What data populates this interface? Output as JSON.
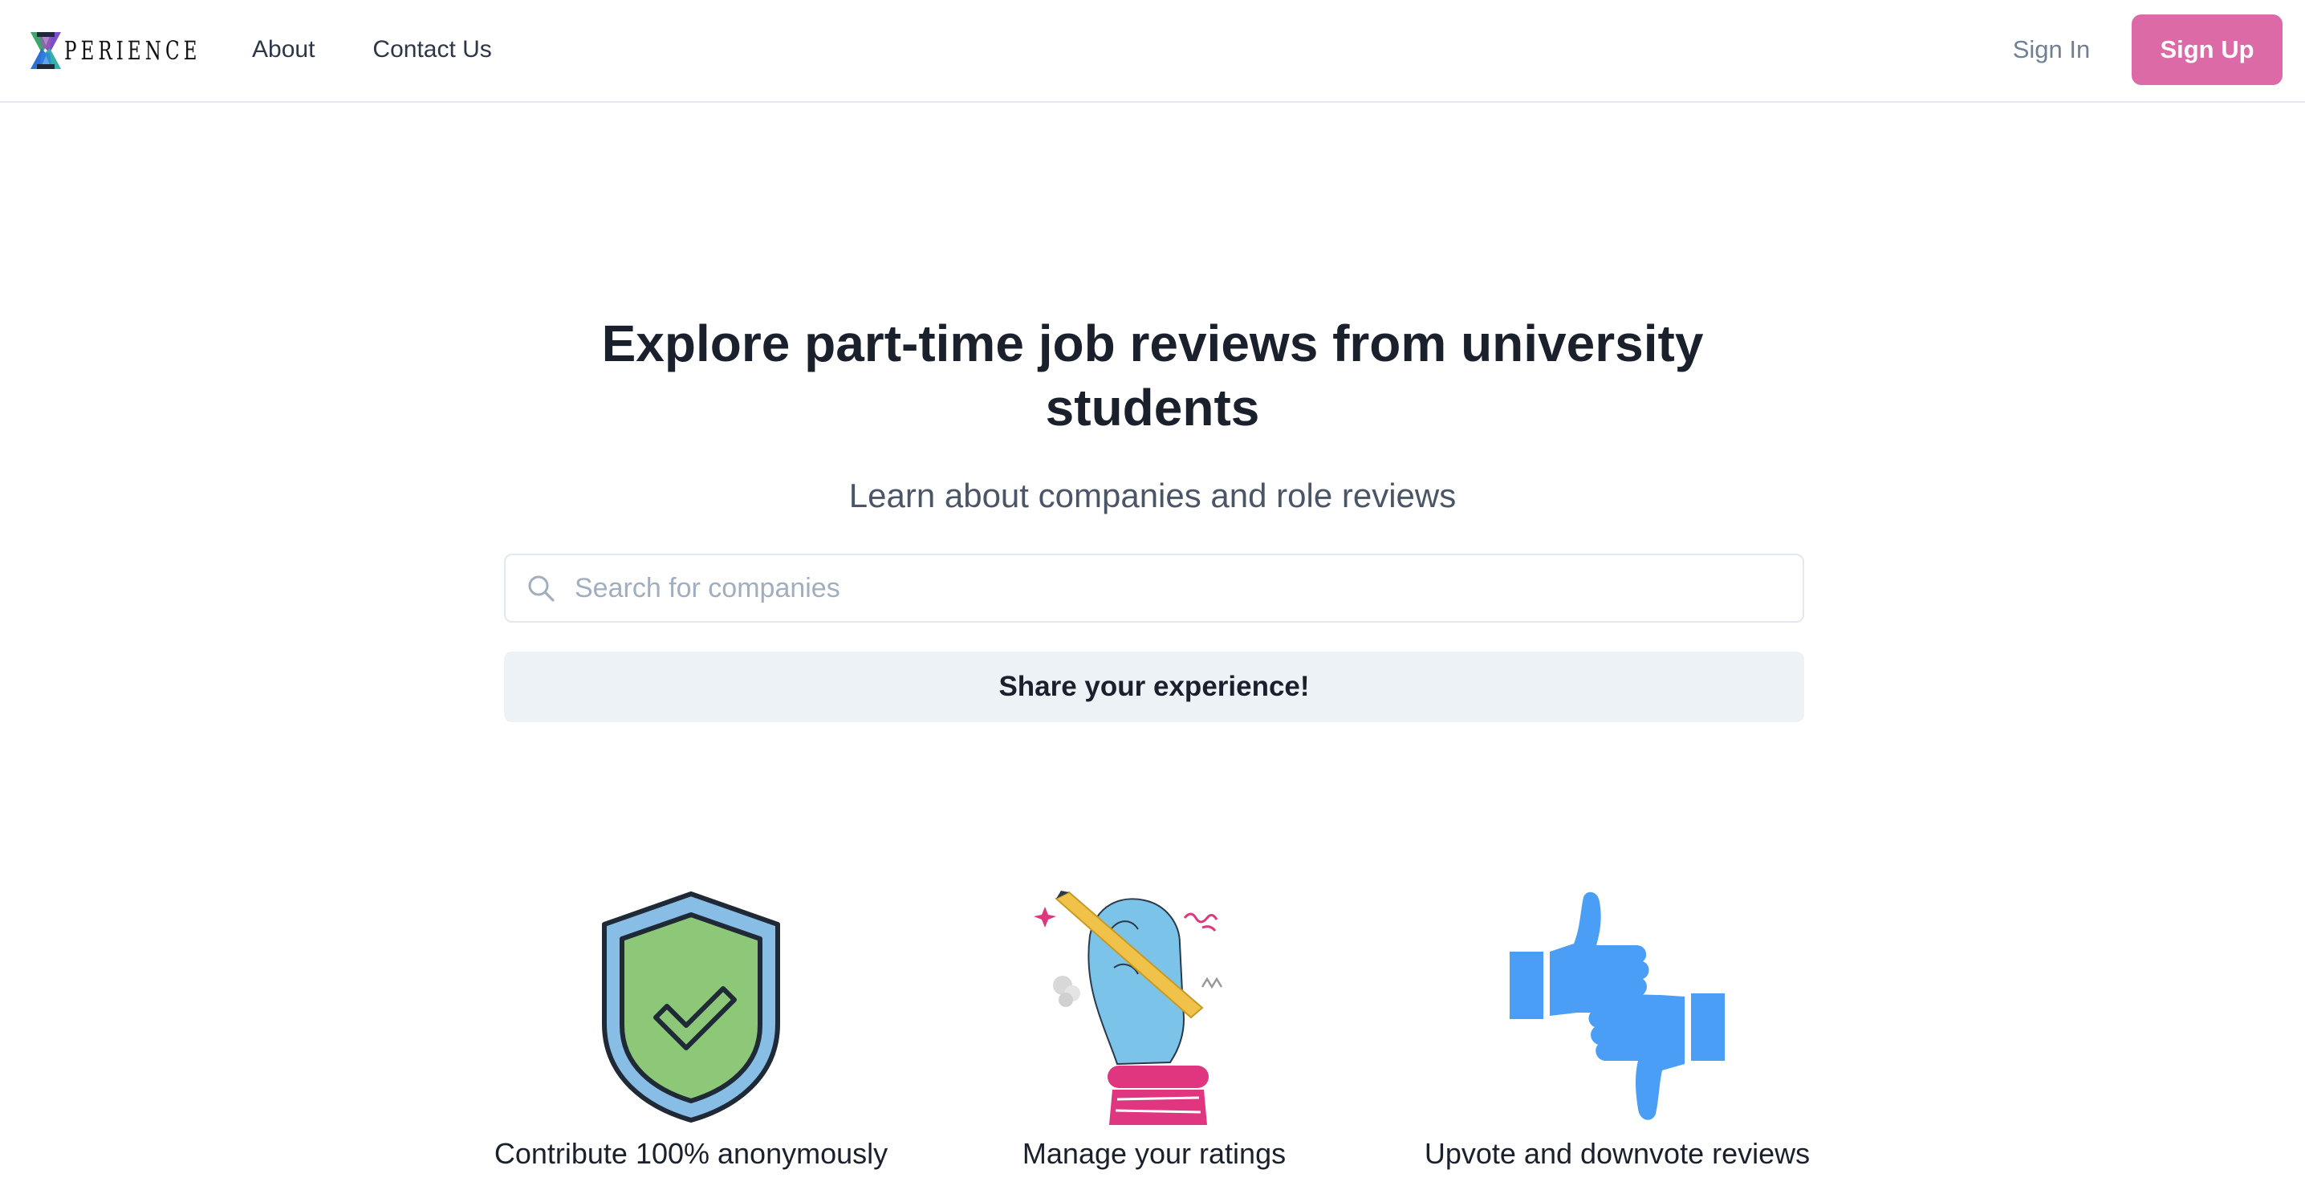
{
  "brand": {
    "logo_text": "PERIENCE"
  },
  "nav": {
    "links": [
      {
        "label": "About"
      },
      {
        "label": "Contact Us"
      }
    ],
    "sign_in": "Sign In",
    "sign_up": "Sign Up"
  },
  "hero": {
    "title": "Explore part-time job reviews from university students",
    "subtitle": "Learn about companies and role reviews",
    "search": {
      "placeholder": "Search for companies",
      "value": ""
    },
    "share_button": "Share your experience!"
  },
  "features": [
    {
      "caption": "Contribute 100% anonymously",
      "icon": "shield-check-icon"
    },
    {
      "caption": "Manage your ratings",
      "icon": "hand-writing-icon"
    },
    {
      "caption": "Upvote and downvote reviews",
      "icon": "thumbs-up-down-icon"
    }
  ],
  "colors": {
    "brand_pink": "#db6aa6",
    "shield_green": "#8dc878",
    "shield_blue": "#88bde6",
    "thumb_blue": "#4b9ef5",
    "hand_blue": "#7cc3ea",
    "cuff_pink": "#e0357f",
    "pencil_yellow": "#f0c24a",
    "share_bg": "#edf2f7"
  }
}
